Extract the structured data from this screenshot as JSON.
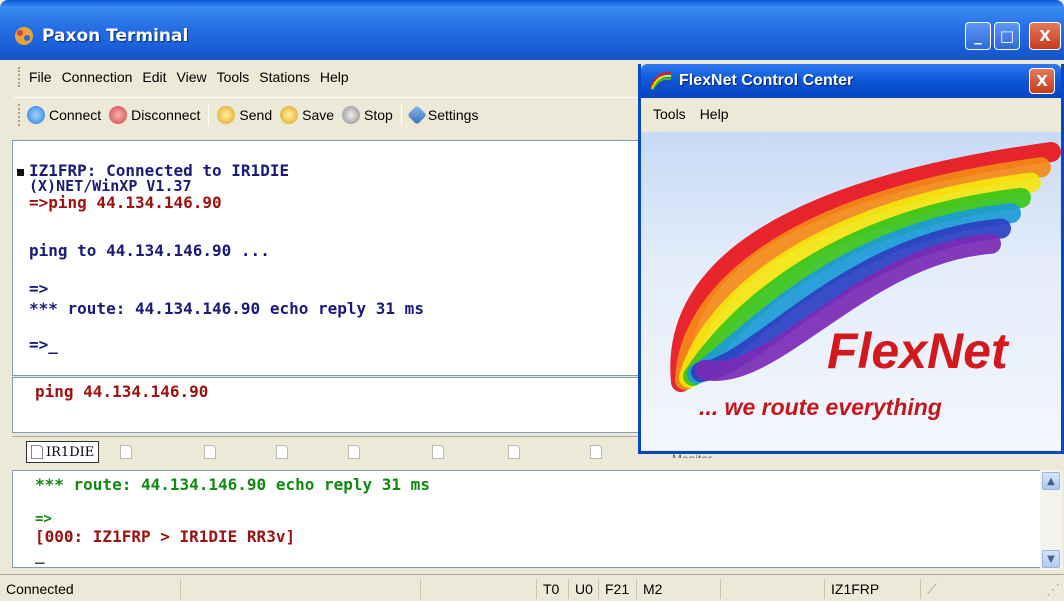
{
  "window": {
    "title": "Paxon Terminal",
    "controls": {
      "minimize": "_",
      "maximize": "□",
      "close": "X"
    }
  },
  "menubar": [
    "File",
    "Connection",
    "Edit",
    "View",
    "Tools",
    "Stations",
    "Help"
  ],
  "toolbar": {
    "connect": "Connect",
    "disconnect": "Disconnect",
    "send": "Send",
    "save": "Save",
    "stop": "Stop",
    "settings": "Settings"
  },
  "main_pane": {
    "lines": [
      {
        "text": "IZ1FRP: Connected to IR1DIE",
        "color": "#1a1a7a"
      },
      {
        "text": "(X)NET/WinXP V1.37",
        "color": "#1a1a7a"
      },
      {
        "text": "=>ping 44.134.146.90",
        "color": "#a01010"
      },
      {
        "text": "ping to 44.134.146.90 ...",
        "color": "#1a1a7a"
      },
      {
        "text": "=>",
        "color": "#1a1a7a"
      },
      {
        "text": "*** route: 44.134.146.90 echo reply 31 ms",
        "color": "#1a1a7a"
      },
      {
        "text": "=>_",
        "color": "#1a1a7a"
      }
    ]
  },
  "input_pane": {
    "text": "ping 44.134.146.90",
    "color": "#a01010"
  },
  "tabs": {
    "active": "IR1DIE"
  },
  "monitor_pane": {
    "label": "Monitor",
    "lines": [
      {
        "text": "*** route: 44.134.146.90 echo reply 31 ms",
        "color": "#0e8a0e"
      },
      {
        "text": "=>",
        "color": "#0e8a0e"
      },
      {
        "text": "[000: IZ1FRP > IR1DIE RR3v]",
        "color": "#9c1010"
      },
      {
        "text": "_",
        "color": "#444444"
      }
    ]
  },
  "statusbar": {
    "status": "Connected",
    "t": "T0",
    "u": "U0",
    "f": "F21",
    "m": "M2",
    "callsign": "IZ1FRP"
  },
  "flexnet": {
    "title": "FlexNet Control Center",
    "close": "X",
    "menu": [
      "Tools",
      "Help"
    ],
    "brand": "FlexNet",
    "tagline": "... we route everything",
    "rainbow_colors": [
      "#e8141b",
      "#f58a17",
      "#f4e60f",
      "#39c41a",
      "#1c9ad6",
      "#2a3fc2",
      "#7a2ab5"
    ]
  }
}
